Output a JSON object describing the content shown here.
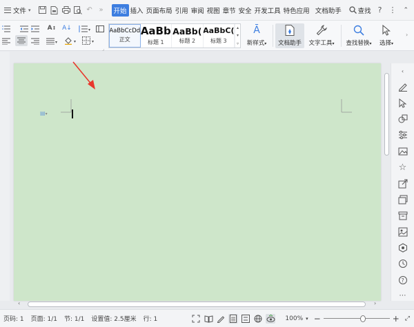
{
  "menubar": {
    "file_label": "文件",
    "tabs": [
      "开始",
      "插入",
      "页面布局",
      "引用",
      "审阅",
      "视图",
      "章节",
      "安全",
      "开发工具",
      "特色应用",
      "文档助手"
    ],
    "active_tab": "开始",
    "search_label": "查找",
    "help_glyph": "?"
  },
  "ribbon": {
    "styles": [
      {
        "sample": "AaBbCcDd",
        "name": "正文"
      },
      {
        "sample": "AaBb",
        "name": "标题 1"
      },
      {
        "sample": "AaBb(",
        "name": "标题 2"
      },
      {
        "sample": "AaBbC(",
        "name": "标题 3"
      }
    ],
    "new_style_label": "新样式",
    "doc_assistant_label": "文档助手",
    "text_tools_label": "文字工具",
    "find_replace_label": "查找替换",
    "select_label": "选择"
  },
  "statusbar": {
    "page_num": "页码: 1",
    "pages": "页面: 1/1",
    "section": "节: 1/1",
    "settings": "设置值: 2.5厘米",
    "row": "行: 1",
    "zoom": "100%",
    "zoom_fraction": 0.6
  },
  "colors": {
    "page_background": "#cee6ca",
    "accent": "#3d7ee0",
    "arrow": "#e8372c"
  }
}
